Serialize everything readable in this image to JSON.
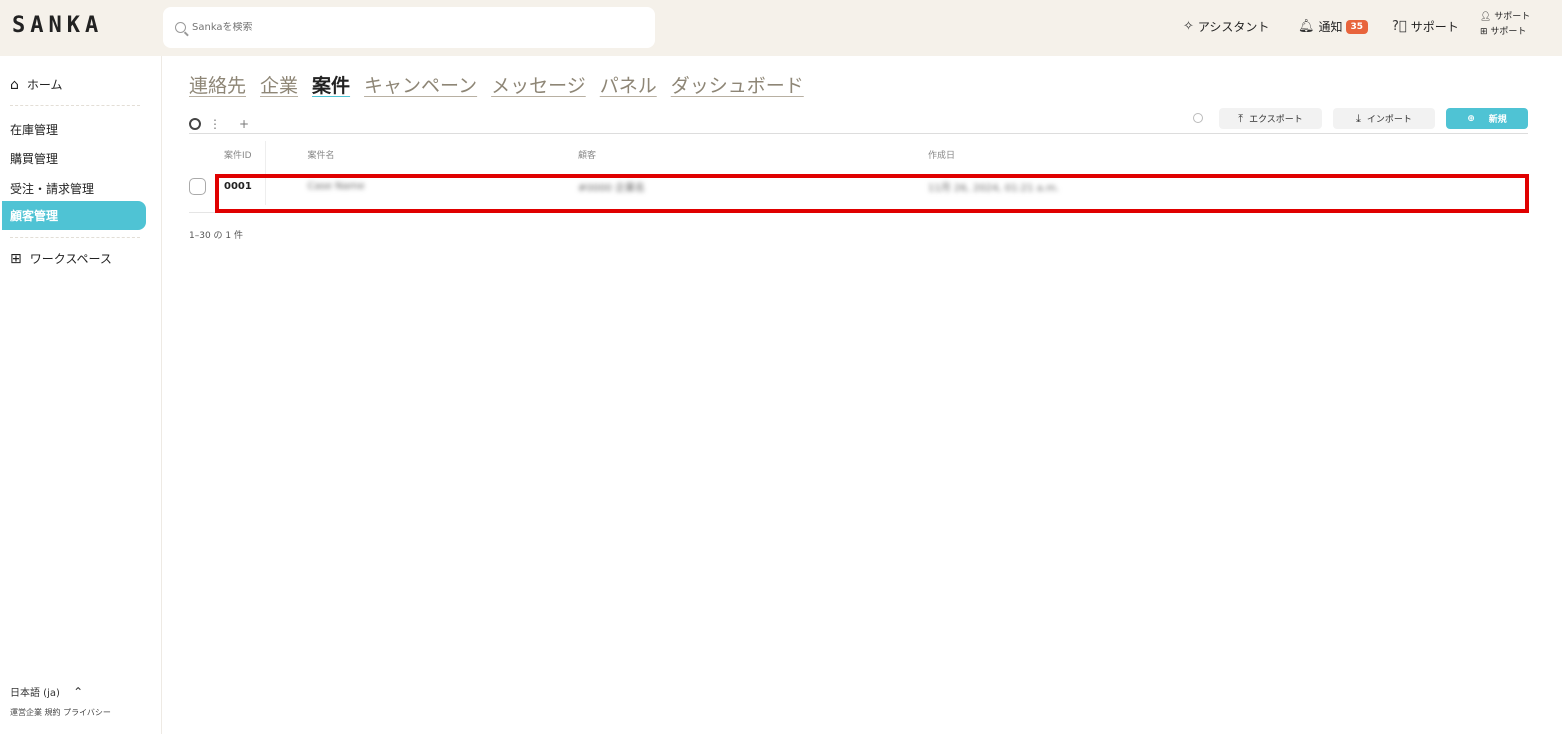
{
  "app": {
    "logo": "SANKA"
  },
  "search": {
    "placeholder": "Sankaを検索"
  },
  "topbar": {
    "assistant_label": "アシスタント",
    "notification_label": "通知",
    "notification_count": "35",
    "support_label": "サポート",
    "user_line1": "サポート",
    "user_line2": "サポート"
  },
  "sidebar": {
    "home": "ホーム",
    "items": [
      "在庫管理",
      "購買管理",
      "受注・請求管理"
    ],
    "active": "顧客管理",
    "workspace": "ワークスペース",
    "language": "日本語 (ja)",
    "footer_links": "運営企業 規約 プライバシー"
  },
  "tabs": [
    {
      "label": "連絡先",
      "active": false
    },
    {
      "label": "企業",
      "active": false
    },
    {
      "label": "案件",
      "active": true
    },
    {
      "label": "キャンペーン",
      "active": false
    },
    {
      "label": "メッセージ",
      "active": false
    },
    {
      "label": "パネル",
      "active": false
    },
    {
      "label": "ダッシュボード",
      "active": false
    }
  ],
  "toolbar": {
    "export_label": "エクスポート",
    "import_label": "インポート",
    "new_label": "新規",
    "add_view": "+"
  },
  "table": {
    "headers": [
      "案件ID",
      "案件名",
      "顧客",
      "作成日"
    ],
    "rows": [
      {
        "id": "0001",
        "name": "Case Name",
        "customer": "#0000 企業名",
        "created": "11月 26, 2024, 01:21 a.m."
      }
    ]
  },
  "pagination": {
    "summary": "1–30 の 1 件"
  },
  "colors": {
    "accent": "#4fc3d4",
    "badge": "#e8643c",
    "highlight": "#e00000",
    "topbar_bg": "#f5f1ea"
  }
}
